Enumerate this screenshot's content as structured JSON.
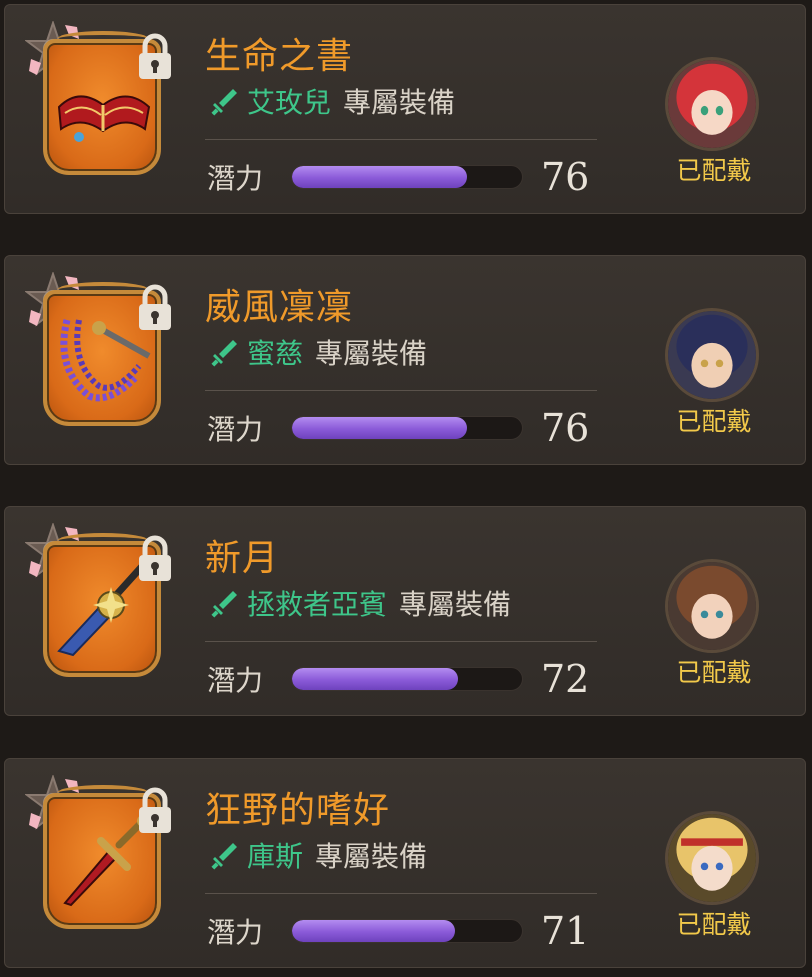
{
  "potential_label": "潛力",
  "exclusive_label": "專屬裝備",
  "equipped_label": "已配戴",
  "cards": [
    {
      "title": "生命之書",
      "owner": "艾玫兒",
      "potential": 76,
      "potential_fill": 0.76,
      "hair_color": "#d4343a"
    },
    {
      "title": "威風凜凜",
      "owner": "蜜慈",
      "potential": 76,
      "potential_fill": 0.76,
      "hair_color": "#2a2f5a"
    },
    {
      "title": "新月",
      "owner": "拯救者亞賓",
      "potential": 72,
      "potential_fill": 0.72,
      "hair_color": "#7a4a2e"
    },
    {
      "title": "狂野的嗜好",
      "owner": "庫斯",
      "potential": 71,
      "potential_fill": 0.71,
      "hair_color": "#e8c46a"
    }
  ],
  "colors": {
    "title": "#f09a2a",
    "owner": "#3ec68a",
    "equipped": "#f2c94a",
    "bar": "#8a5ad8",
    "frame": "#c58a3a"
  },
  "icons": [
    "star-badge-icon",
    "lock-icon",
    "sword-icon"
  ]
}
